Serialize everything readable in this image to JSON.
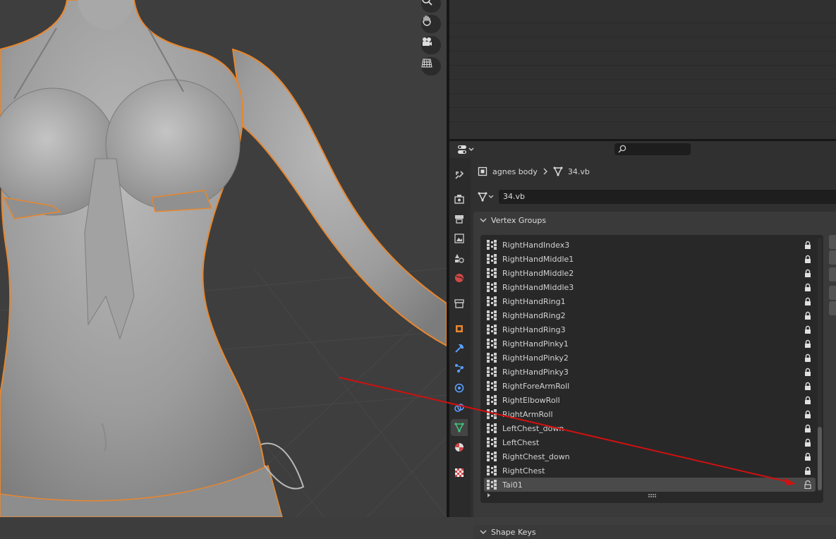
{
  "properties": {
    "breadcrumb": {
      "object": "agnes body",
      "mesh": "34.vb"
    },
    "mesh_data_name": "34.vb",
    "vertex_groups_panel": {
      "title": "Vertex Groups"
    },
    "vertex_groups": [
      {
        "name": "RightHandIndex3"
      },
      {
        "name": "RightHandMiddle1"
      },
      {
        "name": "RightHandMiddle2"
      },
      {
        "name": "RightHandMiddle3"
      },
      {
        "name": "RightHandRing1"
      },
      {
        "name": "RightHandRing2"
      },
      {
        "name": "RightHandRing3"
      },
      {
        "name": "RightHandPinky1"
      },
      {
        "name": "RightHandPinky2"
      },
      {
        "name": "RightHandPinky3"
      },
      {
        "name": "RightForeArmRoll"
      },
      {
        "name": "RightElbowRoll"
      },
      {
        "name": "RightArmRoll"
      },
      {
        "name": "LeftChest_down"
      },
      {
        "name": "LeftChest"
      },
      {
        "name": "RightChest_down"
      },
      {
        "name": "RightChest"
      },
      {
        "name": "Tai01",
        "active": true,
        "lock": "unlocked"
      }
    ],
    "next_panel_title": "Shape Keys"
  },
  "colors": {
    "selection_outline": "#e8862d",
    "annotation_arrow": "#d01010",
    "active_tab": "#3ec47a"
  },
  "icons": {
    "viewport_tools": [
      "zoom-icon",
      "hand-pan-icon",
      "camera-icon",
      "grid-ortho-icon"
    ],
    "property_tabs": [
      "tool-icon",
      "render-icon",
      "output-icon",
      "view-layer-icon",
      "scene-icon",
      "world-icon",
      "collection-icon",
      "object-icon",
      "modifier-icon",
      "particles-icon",
      "physics-icon",
      "constraints-icon",
      "mesh-data-icon",
      "material-icon",
      "texture-icon"
    ]
  }
}
